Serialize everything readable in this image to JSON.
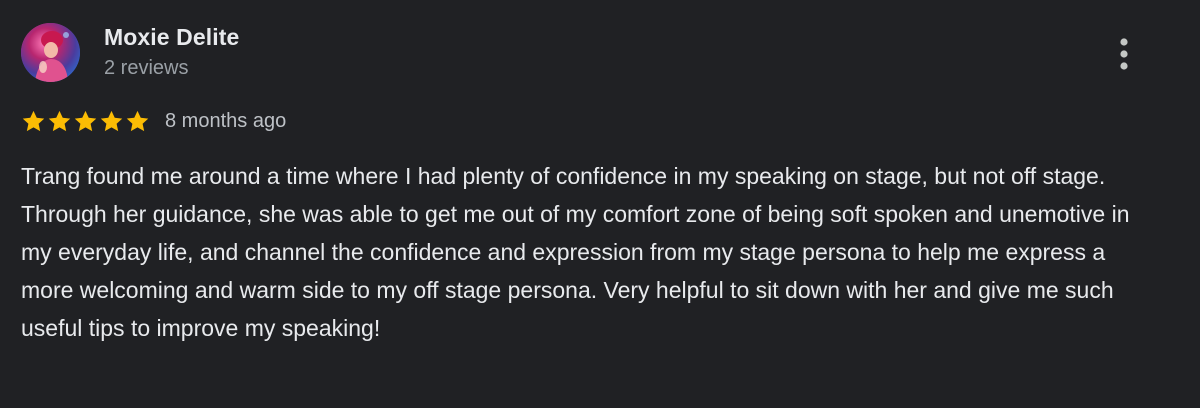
{
  "reviewer": {
    "name": "Moxie Delite",
    "reviews_count": "2 reviews"
  },
  "rating": {
    "stars": 5,
    "max_stars": 5,
    "date": "8 months ago"
  },
  "review": {
    "text": "Trang found me around a time where I had plenty of confidence in my speaking on stage, but not off stage. Through her guidance, she was able to get me out of my comfort zone of being soft spoken and unemotive in my everyday life, and channel the confidence and expression from my stage persona to help me express a more welcoming and warm side to my off stage persona. Very helpful to sit down with her and give me such useful tips to improve my speaking!"
  },
  "icons": {
    "more": "more-vert-icon",
    "star": "star-icon"
  },
  "colors": {
    "background": "#202124",
    "star": "#fbbc04",
    "text": "#e8eaed",
    "secondary_text": "#9aa0a6"
  }
}
